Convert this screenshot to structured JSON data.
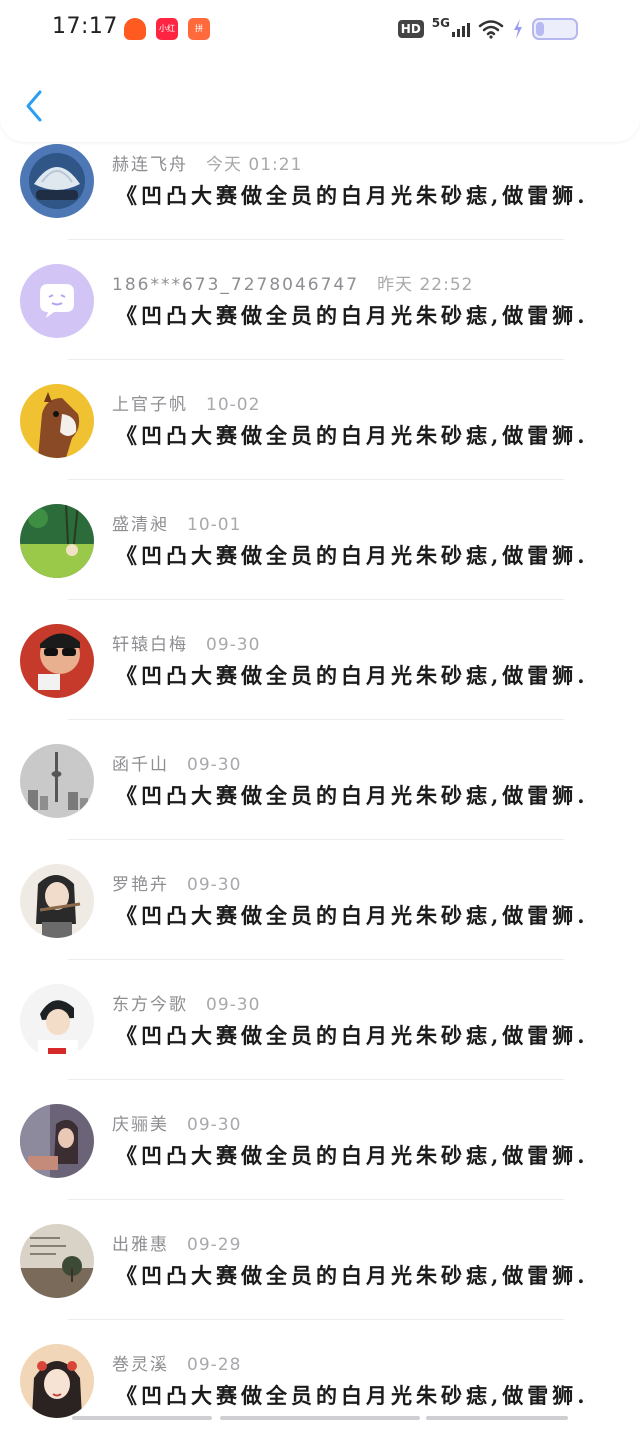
{
  "status_bar": {
    "time": "17:17",
    "apps": [
      {
        "name": "taobao-icon",
        "label": "",
        "color": "#ff5a1f"
      },
      {
        "name": "xiaohongshu-icon",
        "label": "小红书",
        "color": "#ff2442"
      },
      {
        "name": "pinduoduo-icon",
        "label": "拼",
        "color": "#ff6a3d"
      }
    ],
    "hd": "HD",
    "network": "5G",
    "battery_color": "#b5b7f0"
  },
  "header": {
    "back_icon": "chevron-left-icon",
    "accent": "#2a9df4"
  },
  "messages": [
    {
      "name": "赫连飞舟",
      "date": "今天 01:21",
      "text": "《凹凸大赛做全员的白月光朱砂痣,做雷狮…"
    },
    {
      "name": "186***673_7278046747",
      "date": "昨天 22:52",
      "text": "《凹凸大赛做全员的白月光朱砂痣,做雷狮…"
    },
    {
      "name": "上官子帆",
      "date": "10-02",
      "text": "《凹凸大赛做全员的白月光朱砂痣,做雷狮…"
    },
    {
      "name": "盛清昶",
      "date": "10-01",
      "text": "《凹凸大赛做全员的白月光朱砂痣,做雷狮…"
    },
    {
      "name": "轩辕白梅",
      "date": "09-30",
      "text": "《凹凸大赛做全员的白月光朱砂痣,做雷狮…"
    },
    {
      "name": "函千山",
      "date": "09-30",
      "text": "《凹凸大赛做全员的白月光朱砂痣,做雷狮…"
    },
    {
      "name": "罗艳卉",
      "date": "09-30",
      "text": "《凹凸大赛做全员的白月光朱砂痣,做雷狮…"
    },
    {
      "name": "东方今歌",
      "date": "09-30",
      "text": "《凹凸大赛做全员的白月光朱砂痣,做雷狮…"
    },
    {
      "name": "庆骊美",
      "date": "09-30",
      "text": "《凹凸大赛做全员的白月光朱砂痣,做雷狮…"
    },
    {
      "name": "出雅惠",
      "date": "09-29",
      "text": "《凹凸大赛做全员的白月光朱砂痣,做雷狮…"
    },
    {
      "name": "巻灵溪",
      "date": "09-28",
      "text": "《凹凸大赛做全员的白月光朱砂痣,做雷狮…"
    }
  ]
}
